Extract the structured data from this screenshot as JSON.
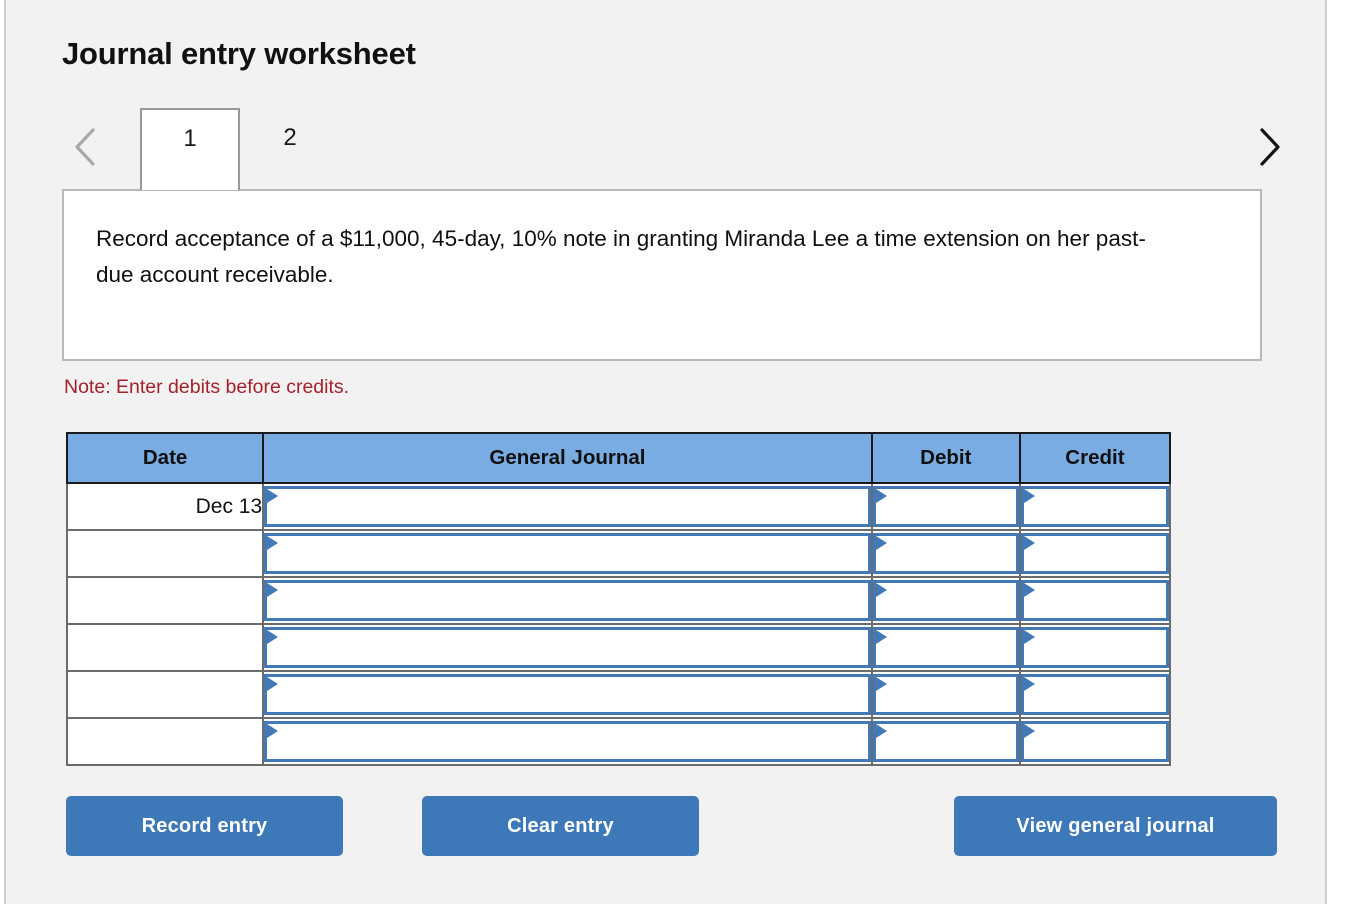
{
  "page": {
    "title": "Journal entry worksheet",
    "panel_bg": "#f2f2f2",
    "accent_blue": "#3d78b8",
    "header_blue": "#7aace4",
    "note_red": "#a4232b"
  },
  "tabs": {
    "prev_icon": "chevron-left-icon",
    "next_icon": "chevron-right-icon",
    "items": [
      {
        "label": "1",
        "active": true
      },
      {
        "label": "2",
        "active": false
      }
    ]
  },
  "description": {
    "text": "Record acceptance of a $11,000, 45-day, 10% note in granting Miranda Lee a time extension on her past-due account receivable."
  },
  "note": {
    "text": "Note: Enter debits before credits."
  },
  "journal_table": {
    "columns": [
      "Date",
      "General Journal",
      "Debit",
      "Credit"
    ],
    "rows": [
      {
        "date": "Dec 13",
        "general_journal": "",
        "debit": "",
        "credit": ""
      },
      {
        "date": "",
        "general_journal": "",
        "debit": "",
        "credit": ""
      },
      {
        "date": "",
        "general_journal": "",
        "debit": "",
        "credit": ""
      },
      {
        "date": "",
        "general_journal": "",
        "debit": "",
        "credit": ""
      },
      {
        "date": "",
        "general_journal": "",
        "debit": "",
        "credit": ""
      },
      {
        "date": "",
        "general_journal": "",
        "debit": "",
        "credit": ""
      }
    ]
  },
  "buttons": {
    "record": "Record entry",
    "clear": "Clear entry",
    "view": "View general journal"
  }
}
